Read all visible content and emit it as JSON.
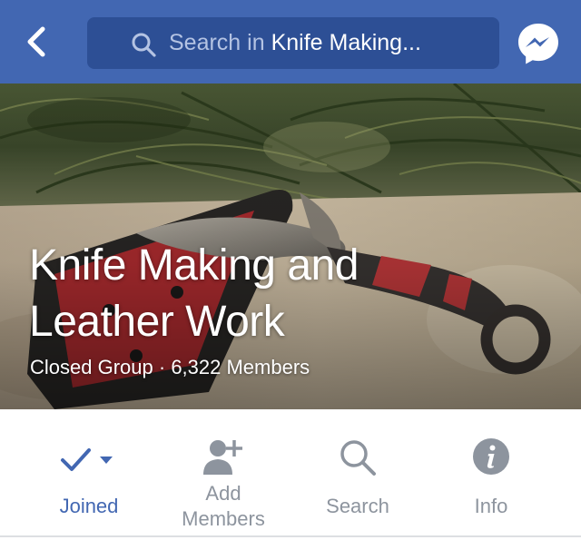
{
  "nav": {
    "search_prefix": "Search in ",
    "search_group": "Knife Making..."
  },
  "cover": {
    "title_line1": "Knife Making and",
    "title_line2": "Leather Work",
    "privacy": "Closed Group",
    "separator": " · ",
    "members": "6,322 Members"
  },
  "actions": [
    {
      "label": "Joined",
      "icon": "checkmark-icon",
      "active": true
    },
    {
      "label_line1": "Add",
      "label_line2": "Members",
      "icon": "add-person-icon"
    },
    {
      "label": "Search",
      "icon": "search-icon"
    },
    {
      "label": "Info",
      "icon": "info-icon"
    }
  ],
  "colors": {
    "nav_bg": "#4267b2",
    "search_bg": "#2d4f95",
    "accent": "#4267b2",
    "inactive": "#8d949e"
  }
}
